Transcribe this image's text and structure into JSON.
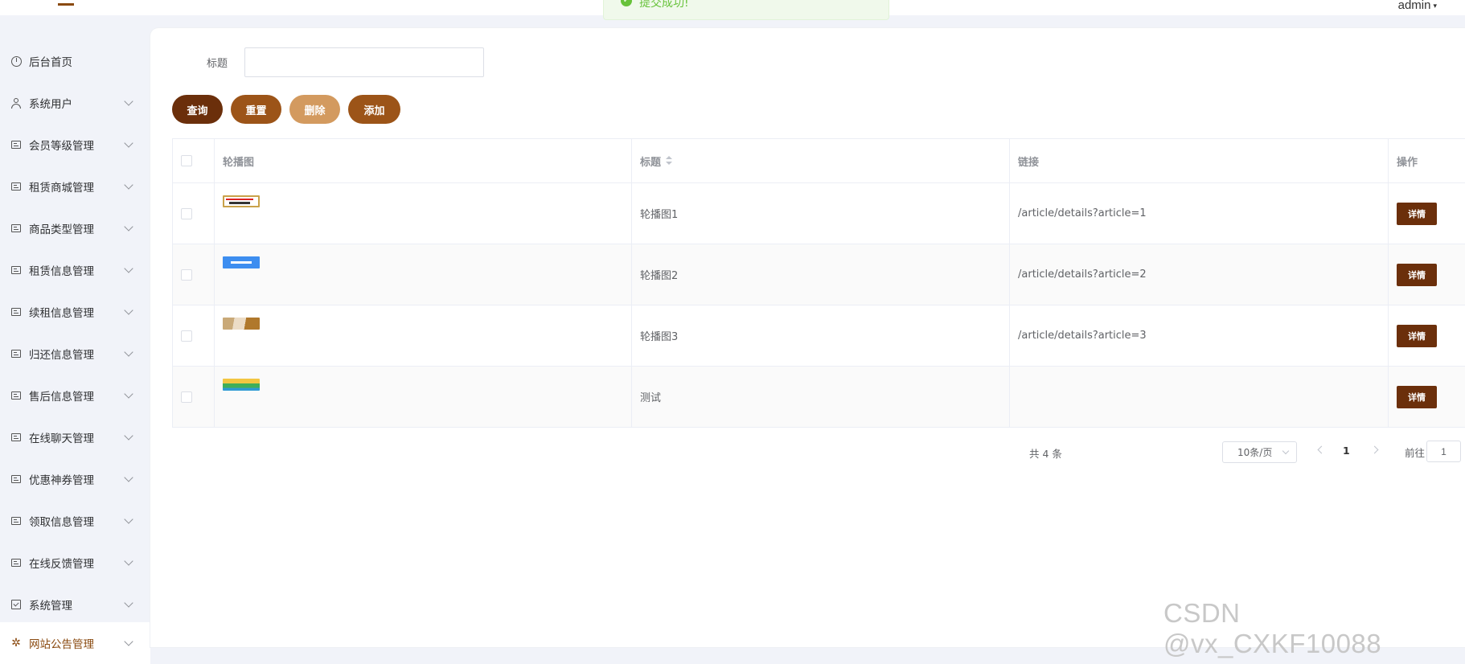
{
  "header": {
    "user": "admin"
  },
  "toast": {
    "message": "提交成功!"
  },
  "sidebar": {
    "items": [
      {
        "label": "后台首页",
        "icon": "clock-icon"
      },
      {
        "label": "系统用户",
        "icon": "user-icon"
      },
      {
        "label": "会员等级管理",
        "icon": "document-icon"
      },
      {
        "label": "租赁商城管理",
        "icon": "document-icon"
      },
      {
        "label": "商品类型管理",
        "icon": "document-icon"
      },
      {
        "label": "租赁信息管理",
        "icon": "document-icon"
      },
      {
        "label": "续租信息管理",
        "icon": "document-icon"
      },
      {
        "label": "归还信息管理",
        "icon": "document-icon"
      },
      {
        "label": "售后信息管理",
        "icon": "document-icon"
      },
      {
        "label": "在线聊天管理",
        "icon": "document-icon"
      },
      {
        "label": "优惠神券管理",
        "icon": "document-icon"
      },
      {
        "label": "领取信息管理",
        "icon": "document-icon"
      },
      {
        "label": "在线反馈管理",
        "icon": "document-icon"
      },
      {
        "label": "系统管理",
        "icon": "check-square-icon"
      },
      {
        "label": "网站公告管理",
        "icon": "loading-icon"
      }
    ]
  },
  "search": {
    "label": "标题",
    "value": "",
    "placeholder": ""
  },
  "buttons": {
    "query": "查询",
    "reset": "重置",
    "delete": "删除",
    "add": "添加"
  },
  "colors": {
    "query": "#6b2f0b",
    "reset": "#9c5418",
    "delete": "#d39a5f",
    "add": "#9c5418"
  },
  "table": {
    "headers": {
      "image": "轮播图",
      "title": "标题",
      "link": "链接",
      "action": "操作"
    },
    "rows": [
      {
        "title": "轮播图1",
        "link": "/article/details?article=1",
        "action": "详情"
      },
      {
        "title": "轮播图2",
        "link": "/article/details?article=2",
        "action": "详情"
      },
      {
        "title": "轮播图3",
        "link": "/article/details?article=3",
        "action": "详情"
      },
      {
        "title": "测试",
        "link": "",
        "action": "详情"
      }
    ]
  },
  "pagination": {
    "total": "共 4 条",
    "page_size": "10条/页",
    "current_page": "1",
    "goto_label": "前往",
    "goto_value": "1"
  },
  "watermark": "CSDN @vx_CXKF10088"
}
